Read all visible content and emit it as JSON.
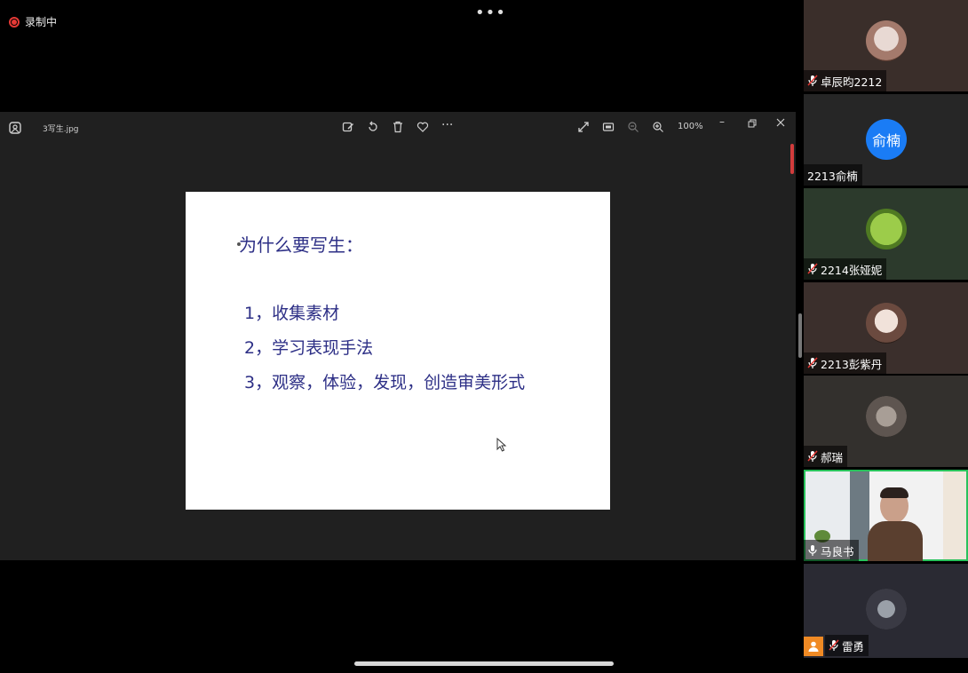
{
  "recording": {
    "label": "录制中"
  },
  "viewer": {
    "filename": "3写生.jpg",
    "zoom": "100%"
  },
  "slide": {
    "title": "为什么要写生：",
    "items": [
      "1，收集素材",
      "2，学习表现手法",
      "3，观察，体验，发现，创造审美形式"
    ]
  },
  "participants": [
    {
      "name": "卓辰昀2212",
      "avatar": "photo",
      "muted": true
    },
    {
      "name": "2213俞楠",
      "avatar_text": "俞楠",
      "muted": false
    },
    {
      "name": "2214张娅妮",
      "avatar": "photo",
      "muted": true
    },
    {
      "name": "2213彭紫丹",
      "avatar": "photo",
      "muted": true
    },
    {
      "name": "郝瑞",
      "avatar": "photo",
      "muted": true
    },
    {
      "name": "马良书",
      "avatar": "video",
      "muted": false,
      "active": true
    },
    {
      "name": "雷勇",
      "avatar": "photo",
      "muted": true
    }
  ],
  "colors": {
    "record_red": "#e53935",
    "active_speaker": "#28c25b",
    "avatar_blue": "#1a7cf5",
    "slide_text": "#2d2f86"
  }
}
